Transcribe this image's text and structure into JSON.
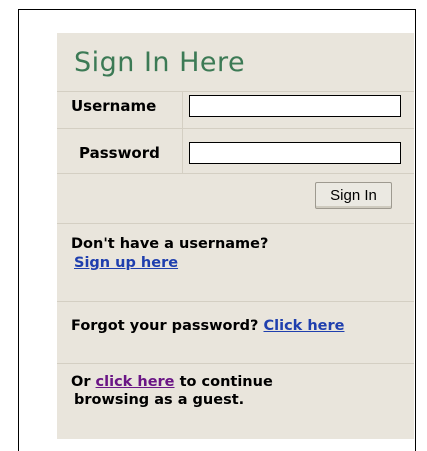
{
  "form": {
    "title": "Sign In Here",
    "username_label": "Username",
    "password_label": "Password",
    "username_value": "",
    "password_value": "",
    "signin_button": "Sign In"
  },
  "signup": {
    "prompt": "Don't have a username?",
    "link": "Sign up here"
  },
  "forgot": {
    "prompt": "Forgot your password?",
    "link": "Click here"
  },
  "guest": {
    "prefix": "Or",
    "link": "click here",
    "suffix_line1": "to continue",
    "line2": "browsing as a guest."
  },
  "colors": {
    "panel_bg": "#e9e5dc",
    "title_green": "#3c7a55",
    "link_blue": "#1f3fae",
    "link_visited": "#6a1585"
  }
}
